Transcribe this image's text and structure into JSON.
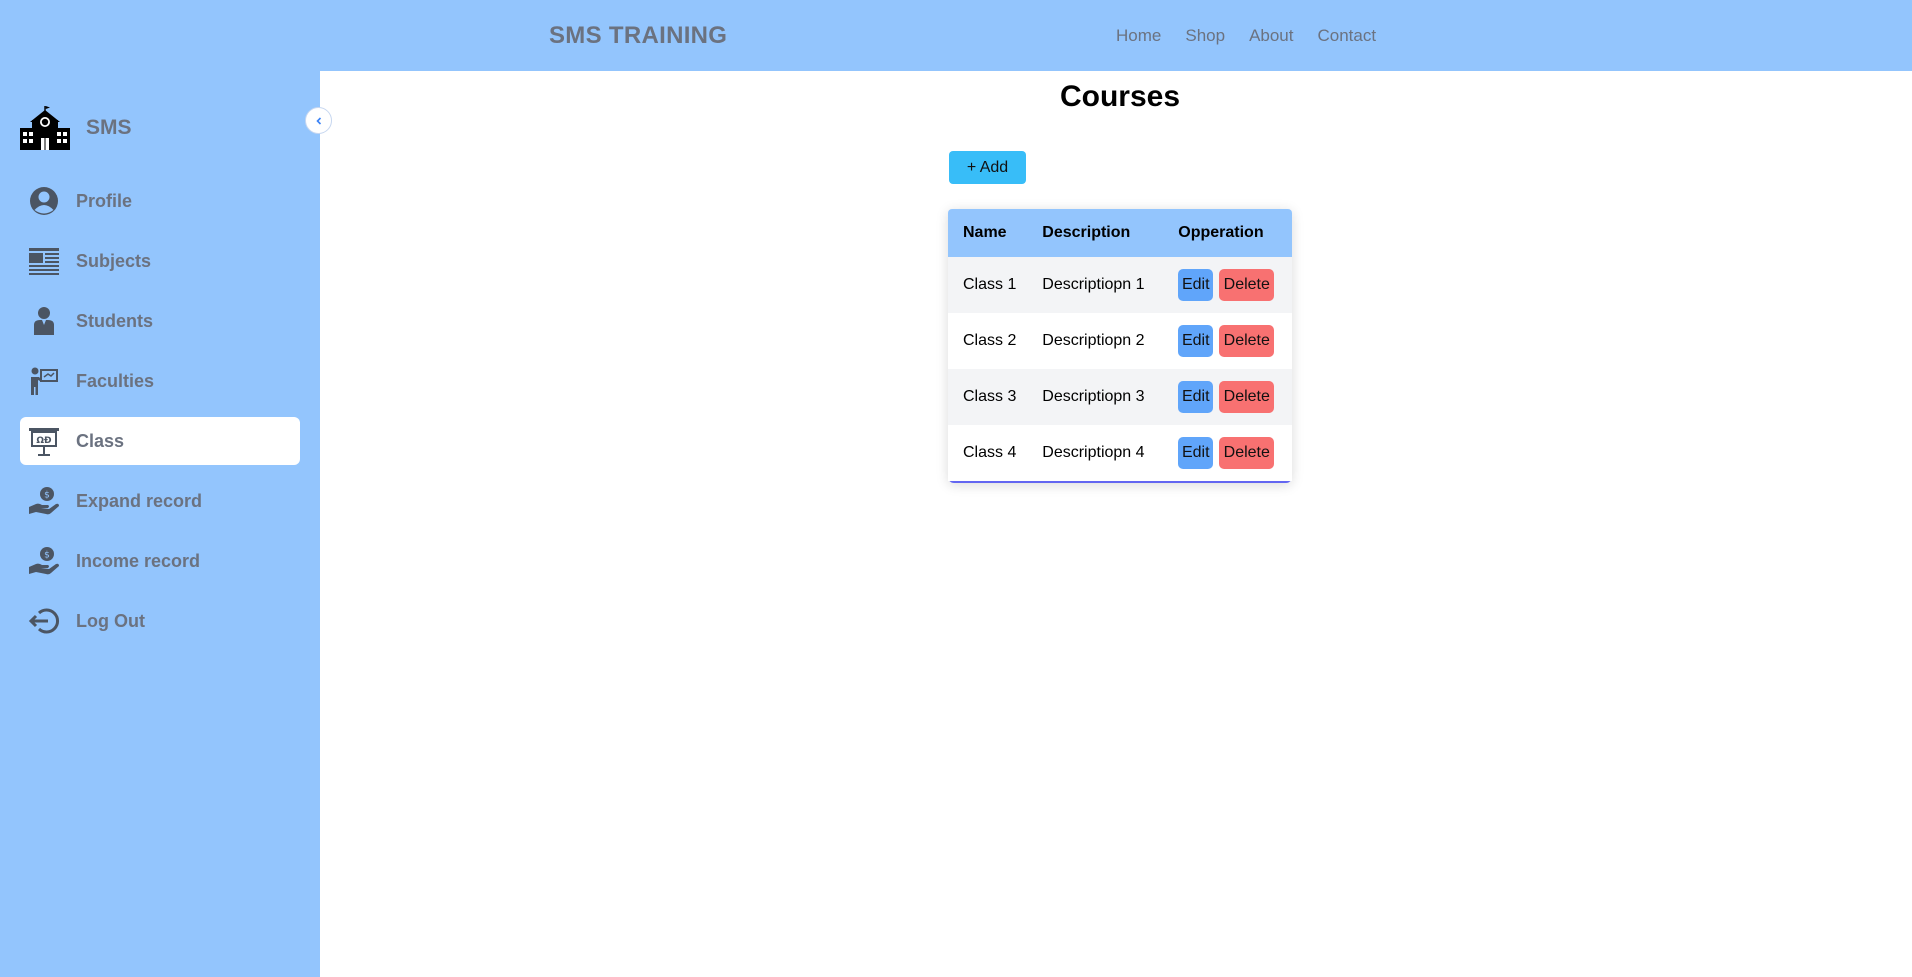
{
  "header": {
    "brand": "SMS TRAINING",
    "nav": [
      "Home",
      "Shop",
      "About",
      "Contact"
    ]
  },
  "sidebar": {
    "logo_text": "SMS",
    "items": [
      {
        "label": "Profile",
        "icon": "profile-icon"
      },
      {
        "label": "Subjects",
        "icon": "subjects-icon"
      },
      {
        "label": "Students",
        "icon": "students-icon"
      },
      {
        "label": "Faculties",
        "icon": "faculties-icon"
      },
      {
        "label": "Class",
        "icon": "class-icon",
        "active": true
      },
      {
        "label": "Expand record",
        "icon": "expense-icon"
      },
      {
        "label": "Income record",
        "icon": "income-icon"
      },
      {
        "label": "Log Out",
        "icon": "logout-icon"
      }
    ]
  },
  "main": {
    "title": "Courses",
    "add_label": "+ Add",
    "table": {
      "headers": [
        "Name",
        "Description",
        "Opperation"
      ],
      "rows": [
        {
          "name": "Class 1",
          "description": "Descriptiopn 1"
        },
        {
          "name": "Class 2",
          "description": "Descriptiopn 2"
        },
        {
          "name": "Class 3",
          "description": "Descriptiopn 3"
        },
        {
          "name": "Class 4",
          "description": "Descriptiopn 4"
        }
      ],
      "edit_label": "Edit",
      "delete_label": "Delete"
    }
  },
  "colors": {
    "accent": "#93c5fd",
    "add_button": "#38bdf8",
    "edit_button": "#60a5fa",
    "delete_button": "#f87171"
  }
}
